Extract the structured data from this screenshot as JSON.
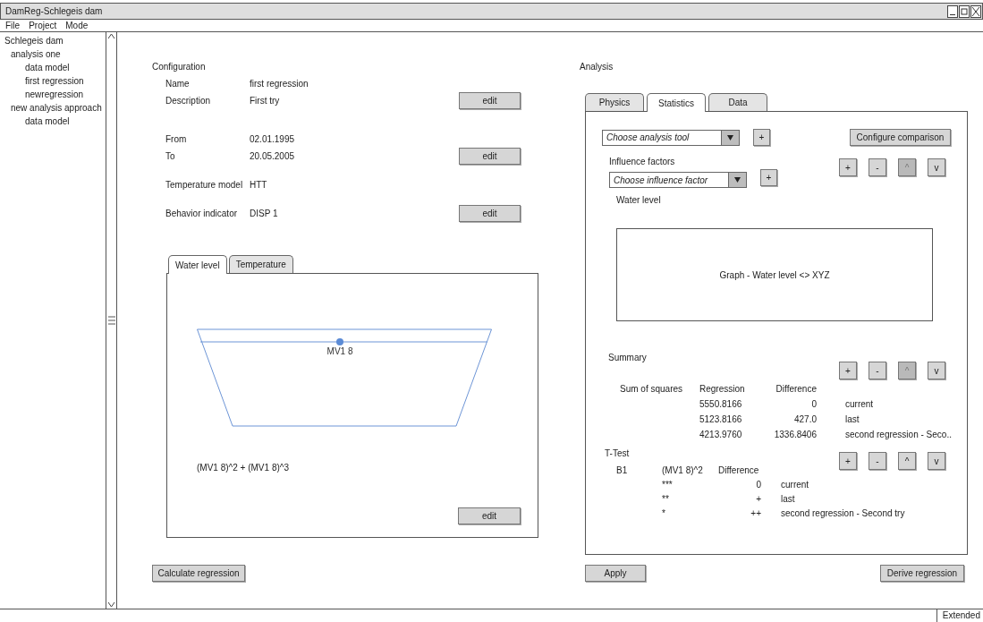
{
  "window": {
    "title": "DamReg-Schlegeis dam"
  },
  "menu": [
    {
      "label": "File"
    },
    {
      "label": "Project"
    },
    {
      "label": "Mode"
    }
  ],
  "sidebar": {
    "tree": [
      {
        "label": "Schlegeis dam",
        "children": [
          {
            "label": "analysis one",
            "children": [
              {
                "label": "data model"
              },
              {
                "label": "first regression"
              },
              {
                "label": "newregression"
              }
            ]
          },
          {
            "label": "new analysis approach",
            "children": [
              {
                "label": "data model"
              }
            ]
          }
        ]
      }
    ]
  },
  "configuration": {
    "title": "Configuration",
    "groups": [
      {
        "rows": [
          {
            "label": "Name",
            "value": "first regression"
          },
          {
            "label": "Description",
            "value": "First try"
          }
        ],
        "button": "edit"
      },
      {
        "rows": [
          {
            "label": "From",
            "value": "02.01.1995"
          },
          {
            "label": "To",
            "value": "20.05.2005"
          }
        ],
        "button": "edit"
      },
      {
        "rows": [
          {
            "label": "Temperature model",
            "value": "HTT"
          }
        ]
      },
      {
        "rows": [
          {
            "label": "Behavior indicator",
            "value": "DISP 1"
          }
        ],
        "button": "edit"
      }
    ],
    "model_tabs": [
      {
        "label": "Water level",
        "selected": true
      },
      {
        "label": "Temperature",
        "selected": false
      }
    ],
    "model_panel": {
      "sensor_label": "MV1 8",
      "formula": "(MV1 8)^2 + (MV1 8)^3",
      "button": "edit"
    },
    "action_button": "Calculate regression"
  },
  "analysis": {
    "title": "Analysis",
    "tabs": [
      {
        "label": "Physics",
        "selected": false
      },
      {
        "label": "Statistics",
        "selected": true
      },
      {
        "label": "Data",
        "selected": false
      }
    ],
    "tool_select": {
      "value": "Choose analysis tool"
    },
    "add_button": "+",
    "configure_button": "Configure comparison",
    "influence": {
      "title": "Influence factors",
      "select": {
        "value": "Choose influence factor"
      },
      "add_button": "+",
      "order_buttons": [
        {
          "label": "+",
          "disabled": false
        },
        {
          "label": "-",
          "disabled": false
        },
        {
          "label": "^",
          "disabled": true
        },
        {
          "label": "v",
          "disabled": false
        }
      ],
      "selected_factor": "Water level",
      "graph": "Graph - Water level <> XYZ"
    },
    "summary": {
      "title": "Summary",
      "order_buttons": [
        {
          "label": "+",
          "disabled": false
        },
        {
          "label": "-",
          "disabled": false
        },
        {
          "label": "^",
          "disabled": true
        },
        {
          "label": "v",
          "disabled": false
        }
      ],
      "columns": [
        "Sum of squares",
        "Regression",
        "Difference"
      ],
      "rows": [
        {
          "regression": "5550.8166",
          "difference": "0",
          "label": "current"
        },
        {
          "regression": "5123.8166",
          "difference": "427.0",
          "label": "last"
        },
        {
          "regression": "4213.9760",
          "difference": "1336.8406",
          "label": "second regression - Seco.."
        }
      ]
    },
    "t_test": {
      "title": "T-Test",
      "order_buttons": [
        {
          "label": "+",
          "disabled": false
        },
        {
          "label": "-",
          "disabled": false
        },
        {
          "label": "^",
          "disabled": false
        },
        {
          "label": "v",
          "disabled": false
        }
      ],
      "columns": [
        "B1",
        "(MV1 8)^2",
        "Difference"
      ],
      "rows": [
        {
          "significance": "***",
          "difference": "0",
          "label": "current"
        },
        {
          "significance": "**",
          "difference": "+",
          "label": "last"
        },
        {
          "significance": "*",
          "difference": "++",
          "label": "second regression - Second try"
        }
      ]
    },
    "apply_button": "Apply",
    "derive_button": "Derive regression"
  },
  "status_bar": {
    "mode": "Extended"
  }
}
